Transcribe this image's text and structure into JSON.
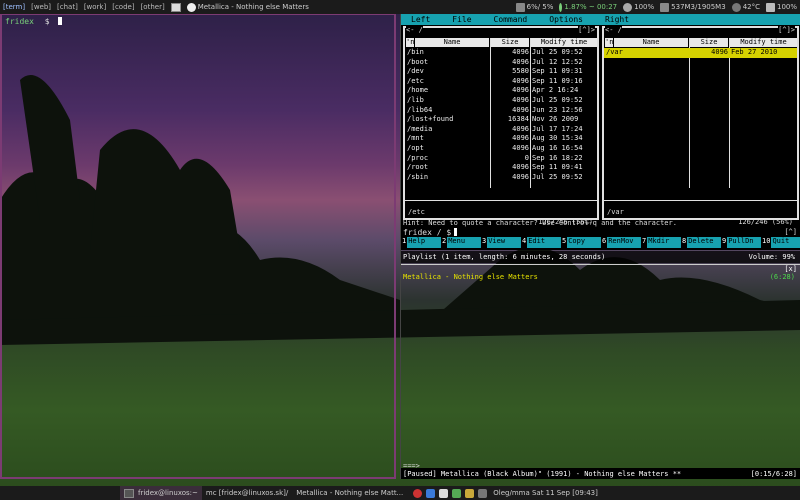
{
  "topbar": {
    "tags": [
      "[term]",
      "[web]",
      "[chat]",
      "[work]",
      "[code]",
      "[other]"
    ],
    "layout_icon": "layout-icon",
    "now_playing": "Metallica - Nothing else Matters",
    "cpu": "6%/ 5%",
    "net": "1.87% ~ 00:27",
    "wifi": "100%",
    "mem": "537M3/1905M3",
    "temp": "42°C",
    "battery": "100%"
  },
  "left_terminal": {
    "prompt_user": "fridex",
    "prompt_symbol": "$"
  },
  "mc": {
    "menu": [
      "Left",
      "File",
      "Command",
      "Options",
      "Right"
    ],
    "left_panel": {
      "path": "<- /",
      "arrows": "[^]>",
      "columns": [
        "'n",
        "Name",
        "Size",
        "Modify time"
      ],
      "rows": [
        {
          "name": "/bin",
          "size": "4096",
          "mtime": "Jul 25 09:52"
        },
        {
          "name": "/boot",
          "size": "4096",
          "mtime": "Jul 12 12:52"
        },
        {
          "name": "/dev",
          "size": "5580",
          "mtime": "Sep 11 09:31"
        },
        {
          "name": "/etc",
          "size": "4096",
          "mtime": "Sep 11 09:16"
        },
        {
          "name": "/home",
          "size": "4096",
          "mtime": "Apr  2 16:24"
        },
        {
          "name": "/lib",
          "size": "4096",
          "mtime": "Jul 25 09:52"
        },
        {
          "name": "/lib64",
          "size": "4096",
          "mtime": "Jun 23 12:56"
        },
        {
          "name": "/lost+found",
          "size": "16384",
          "mtime": "Nov 26  2009"
        },
        {
          "name": "/media",
          "size": "4096",
          "mtime": "Jul 17 17:24"
        },
        {
          "name": "/mnt",
          "size": "4096",
          "mtime": "Aug 30 15:34"
        },
        {
          "name": "/opt",
          "size": "4096",
          "mtime": "Aug 16 16:54"
        },
        {
          "name": "/proc",
          "size": "0",
          "mtime": "Sep 16 18:22"
        },
        {
          "name": "/root",
          "size": "4096",
          "mtime": "Sep 11 09:41"
        },
        {
          "name": "/sbin",
          "size": "4096",
          "mtime": "Jul 25 09:52"
        }
      ],
      "current": "/etc",
      "count": "126/246 (56%)"
    },
    "right_panel": {
      "path": "<- /",
      "arrows": "[^]>",
      "columns": [
        "'n",
        "Name",
        "Size",
        "Modify time"
      ],
      "rows": [
        {
          "name": "/var",
          "size": "4096",
          "mtime": "Feb 27  2010"
        }
      ],
      "current": "/var",
      "count": "126/246 (56%)"
    },
    "hint": "Hint: Need to quote a character? Use Control-q and the character.",
    "prompt": "fridex / $",
    "caret": "[^]",
    "fkeys": [
      {
        "n": "1",
        "label": "Help"
      },
      {
        "n": "2",
        "label": "Menu"
      },
      {
        "n": "3",
        "label": "View"
      },
      {
        "n": "4",
        "label": "Edit"
      },
      {
        "n": "5",
        "label": "Copy"
      },
      {
        "n": "6",
        "label": "RenMov"
      },
      {
        "n": "7",
        "label": "Mkdir"
      },
      {
        "n": "8",
        "label": "Delete"
      },
      {
        "n": "9",
        "label": "PullDn"
      },
      {
        "n": "10",
        "label": "Quit"
      }
    ]
  },
  "player": {
    "header": "Playlist (1 item, length: 6 minutes, 28 seconds)",
    "volume": "Volume: 99%",
    "close": "[x]",
    "track": "Metallica - Nothing else Matters",
    "length": "(6:28)",
    "progress": "===>",
    "status": "[Paused] Metallica (Black Album)\" (1991) - Nothing else Matters ** [0:15/6:28]",
    "status_main": "[Paused] Metallica (Black Album)\" (1991)  -  Nothing else Matters **",
    "status_time": "[0:15/6:28]",
    "progress_fraction": 0.04
  },
  "taskbar": {
    "tasks": [
      {
        "label": "fridex@linuxos:~",
        "active": true
      },
      {
        "label": "mc [fridex@linuxos.sk]/",
        "active": false
      },
      {
        "label": "Metallica - Nothing else Matt...",
        "active": false
      }
    ],
    "clock": "Oleg/mma Sat 11 Sep [09:43]"
  },
  "colors": {
    "mc_cyan": "#17a2b0",
    "selection": "#d6d200",
    "border_active": "#7c3b73",
    "track_yellow": "#e6e200",
    "length_green": "#4cd84c"
  }
}
